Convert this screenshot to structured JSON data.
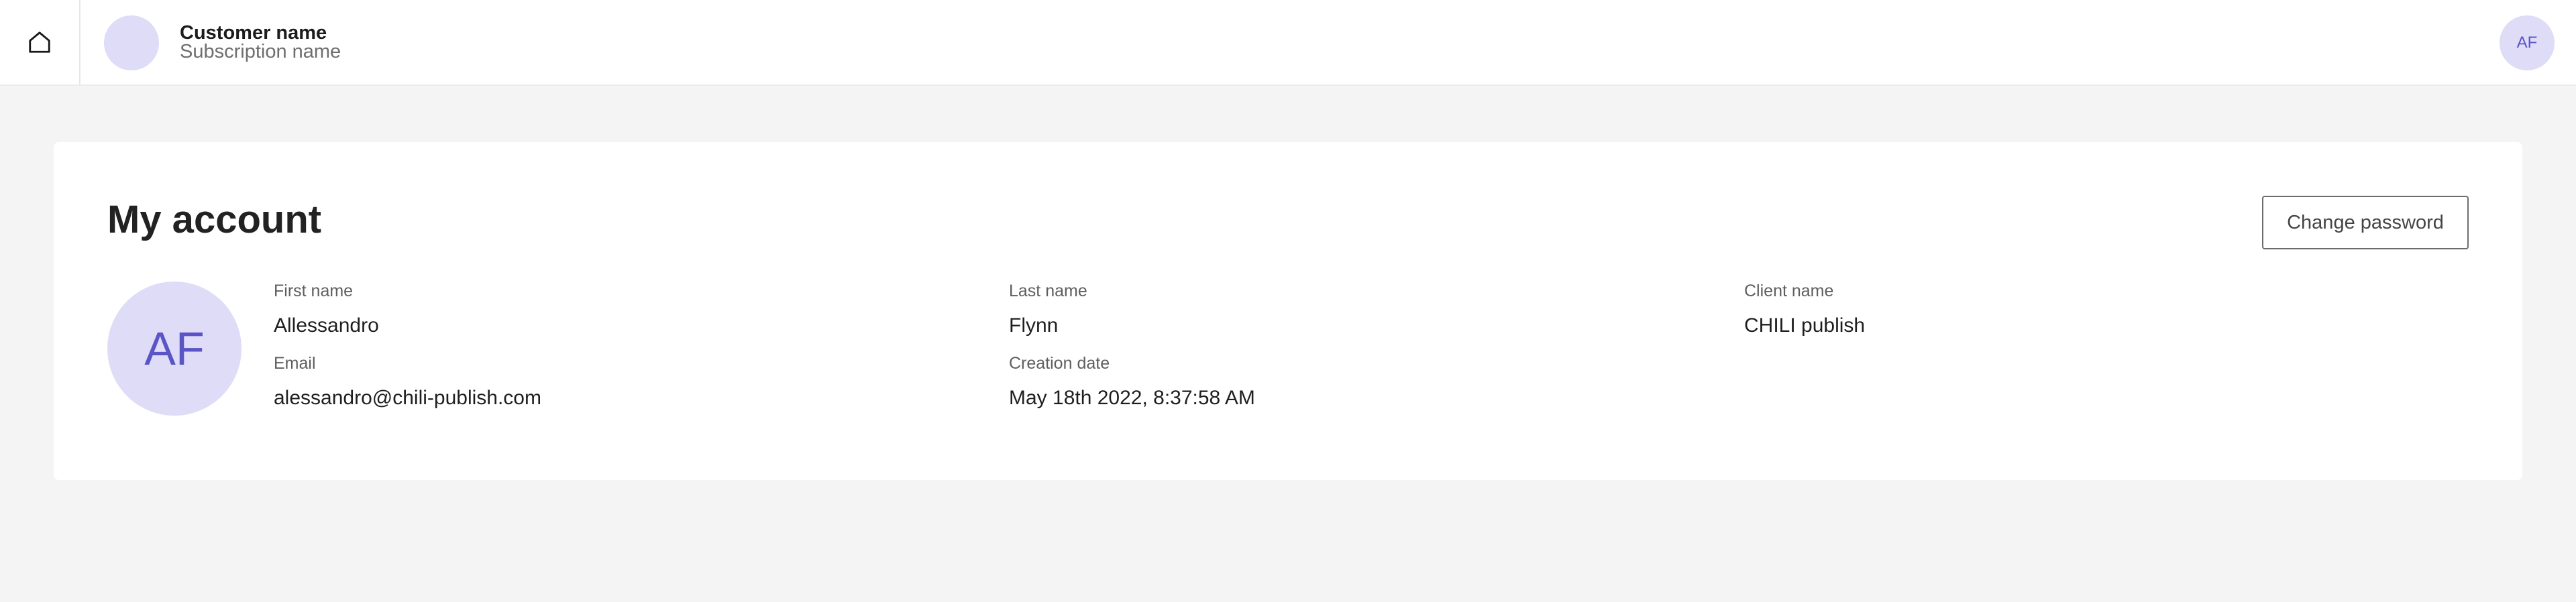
{
  "topbar": {
    "home_icon": "home-icon",
    "customer_name": "Customer name",
    "subscription_name": "Subscription name",
    "user_initials": "AF"
  },
  "account": {
    "title": "My account",
    "change_password_label": "Change password",
    "avatar_initials": "AF",
    "fields": {
      "first_name_label": "First name",
      "first_name": "Allessandro",
      "last_name_label": "Last name",
      "last_name": "Flynn",
      "client_name_label": "Client name",
      "client_name": "CHILI publish",
      "email_label": "Email",
      "email": "alessandro@chili-publish.com",
      "creation_date_label": "Creation date",
      "creation_date": "May 18th 2022, 8:37:58 AM"
    }
  },
  "colors": {
    "background": "#f4f4f4",
    "avatar_bg": "#dedcf7",
    "avatar_text": "#5b54c6"
  }
}
